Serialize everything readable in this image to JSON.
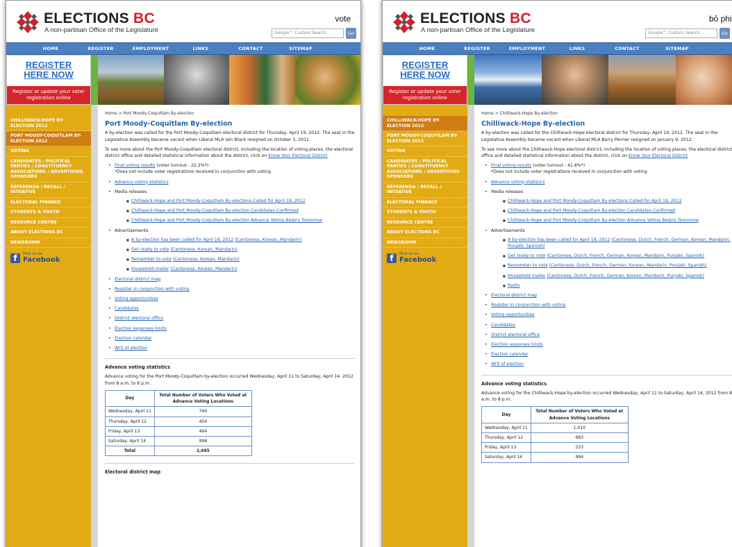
{
  "colors": {
    "nav": "#4a7fc1",
    "sidebar": "#e2ab14",
    "accent_red": "#d21f28",
    "link": "#1e5fb0"
  },
  "brand": {
    "name_main": "ELECTIONS",
    "name_bc": "BC",
    "tagline": "A non-partisan Office of the Legislature"
  },
  "search": {
    "placeholder": "Google™ Custom Search",
    "button": "Go"
  },
  "nav": [
    "HOME",
    "REGISTER",
    "EMPLOYMENT",
    "LINKS",
    "CONTACT",
    "SITEMAP"
  ],
  "register": {
    "title_line1": "REGISTER",
    "title_line2": "HERE NOW",
    "sub": "Register or update your voter registration online"
  },
  "facebook": {
    "find": "Find us on",
    "name": "Facebook"
  },
  "page1": {
    "lang": "vote",
    "sidebar": [
      "CHILLIWACK-HOPE BY-ELECTION 2012",
      "PORT MOODY-COQUITLAM BY-ELECTION 2012",
      "VOTING",
      "CANDIDATES / POLITICAL PARTIES / CONSTITUENCY ASSOCIATIONS / ADVERTISING SPONSORS",
      "REFERENDA / RECALL / INITIATIVE",
      "ELECTORAL FINANCE",
      "STUDENTS & YOUTH",
      "RESOURCE CENTRE",
      "ABOUT ELECTIONS BC",
      "NEWSROOM"
    ],
    "crumb": "Home > Port Moody-Coquitlam By-election",
    "title": "Port Moody-Coquitlam By-election",
    "intro": "A by-election was called for the Port Moody-Coquitlam electoral district for Thursday, April 19, 2012. The seat in the Legislative Assembly became vacant when Liberal MLA Iain Black resigned on October 3, 2011.",
    "more_text": "To see more about the Port Moody-Coquitlam electoral district, including the location of voting places, the electoral district office and detailed statistical information about the district, click on ",
    "more_link": "Know Your Electoral District",
    "final_link": "Final voting results",
    "final_turnout": " (voter turnout - 22.2%*)",
    "final_note": "*Does not include voter registrations received in conjunction with voting.",
    "adv_link": "Advance voting statistics",
    "media_label": "Media releases",
    "media": [
      "Chilliwack-Hope and Port Moody-Coquitlam By-elections Called for April 19, 2012",
      "Chilliwack-Hope and Port Moody-Coquitlam By-election Candidates Confirmed",
      "Chilliwack-Hope and Port Moody-Coquitlam By-election Advance Voting Begins Tomorrow"
    ],
    "ads_label": "Advertisements",
    "ads": [
      {
        "link": "A by-election has been called for April 19, 2012",
        "langs": "(Cantonese, Korean, Mandarin)"
      },
      {
        "link": "Get ready to vote",
        "langs": "(Cantonese, Korean, Mandarin)"
      },
      {
        "link": "Remember to vote",
        "langs": "(Cantonese, Korean, Mandarin)"
      },
      {
        "link": "Household mailer",
        "langs": "(Cantonese, Korean, Mandarin)"
      }
    ],
    "links": [
      "Electoral district map",
      "Register in conjunction with voting",
      "Voting opportunities",
      "Candidates",
      "District electoral office",
      "Election expenses limits",
      "Election calendar",
      "Writ of election"
    ],
    "adv_title": "Advance voting statistics",
    "adv_text": "Advance voting for the Port Moody-Coquitlam by-election occurred Wednesday, April 11 to Saturday, April 14, 2012 from 8 a.m. to 8 p.m.",
    "table_head": [
      "Day",
      "Total Number of Voters Who Voted at Advance Voting Locations"
    ],
    "table_rows": [
      [
        "Wednesday, April 11",
        "749"
      ],
      [
        "Thursday, April 12",
        "454"
      ],
      [
        "Friday, April 13",
        "464"
      ],
      [
        "Saturday, April 14",
        "998"
      ]
    ],
    "table_total": [
      "Total",
      "2,665"
    ],
    "map_title": "Electoral district map"
  },
  "page2": {
    "lang": "bỏ phiếu",
    "sidebar": [
      "CHILLIWACK-HOPE BY-ELECTION 2012",
      "PORT MOODY-COQUITLAM BY-ELECTION 2012",
      "VOTING",
      "CANDIDATES / POLITICAL PARTIES / CONSTITUENCY ASSOCIATIONS / ADVERTISING SPONSORS",
      "REFERENDA / RECALL / INITIATIVE",
      "ELECTORAL FINANCE",
      "STUDENTS & YOUTH",
      "RESOURCE CENTRE",
      "ABOUT ELECTIONS BC",
      "NEWSROOM"
    ],
    "crumb": "Home > Chilliwack-Hope By-election",
    "title": "Chilliwack-Hope By-election",
    "intro": "A by-election was called for the Chilliwack-Hope electoral district for Thursday, April 19, 2012. The seat in the Legislative Assembly became vacant when Liberal MLA Barry Penner resigned on January 9, 2012.",
    "more_text": "To see more about the Chilliwack-Hope electoral district, including the location of voting places, the electoral district office and detailed statistical information about the district, click on ",
    "more_link": "Know Your Electoral District",
    "final_link": "Final voting results",
    "final_turnout": " (voter turnout - 41.8%*)",
    "final_note": "*Does not include voter registrations received in conjunction with voting",
    "adv_link": "Advance voting statistics",
    "media_label": "Media releases",
    "media": [
      "Chilliwack-Hope and Port Moody-Coquitlam By-elections Called for April 19, 2012",
      "Chilliwack-Hope and Port Moody-Coquitlam By-election Candidates Confirmed",
      "Chilliwack-Hope and Port Moody-Coquitlam By-election Advance Voting Begins Tomorrow"
    ],
    "ads_label": "Advertisements",
    "ads": [
      {
        "link": "A by-election has been called for April 19, 2012",
        "langs": "(Cantonese, Dutch, French, German, Korean, Mandarin, Punjabi, Spanish)"
      },
      {
        "link": "Get ready to vote",
        "langs": "(Cantonese, Dutch, French, German, Korean, Mandarin, Punjabi, Spanish)"
      },
      {
        "link": "Remember to vote",
        "langs": "(Cantonese, Dutch, French, German, Korean, Mandarin, Punjabi, Spanish)"
      },
      {
        "link": "Household mailer",
        "langs": "(Cantonese, Dutch, French, German, Korean, Mandarin, Punjabi, Spanish)"
      },
      {
        "link": "Radio",
        "langs": ""
      }
    ],
    "links": [
      "Electoral district map",
      "Register in conjunction with voting",
      "Voting opportunities",
      "Candidates",
      "District electoral office",
      "Election expenses limits",
      "Election calendar",
      "Writ of election"
    ],
    "adv_title": "Advance voting statistics",
    "adv_text": "Advance voting for the Chilliwack-Hope by-election occurred Wednesday, April 11 to Saturday, April 14, 2012 from 8 a.m. to 8 p.m.",
    "table_head": [
      "Day",
      "Total Number of Voters Who Voted at Advance Voting Locations"
    ],
    "table_rows": [
      [
        "Wednesday, April 11",
        "1,010"
      ],
      [
        "Thursday, April 12",
        "683"
      ],
      [
        "Friday, April 13",
        "533"
      ],
      [
        "Saturday, April 14",
        "994"
      ]
    ]
  }
}
